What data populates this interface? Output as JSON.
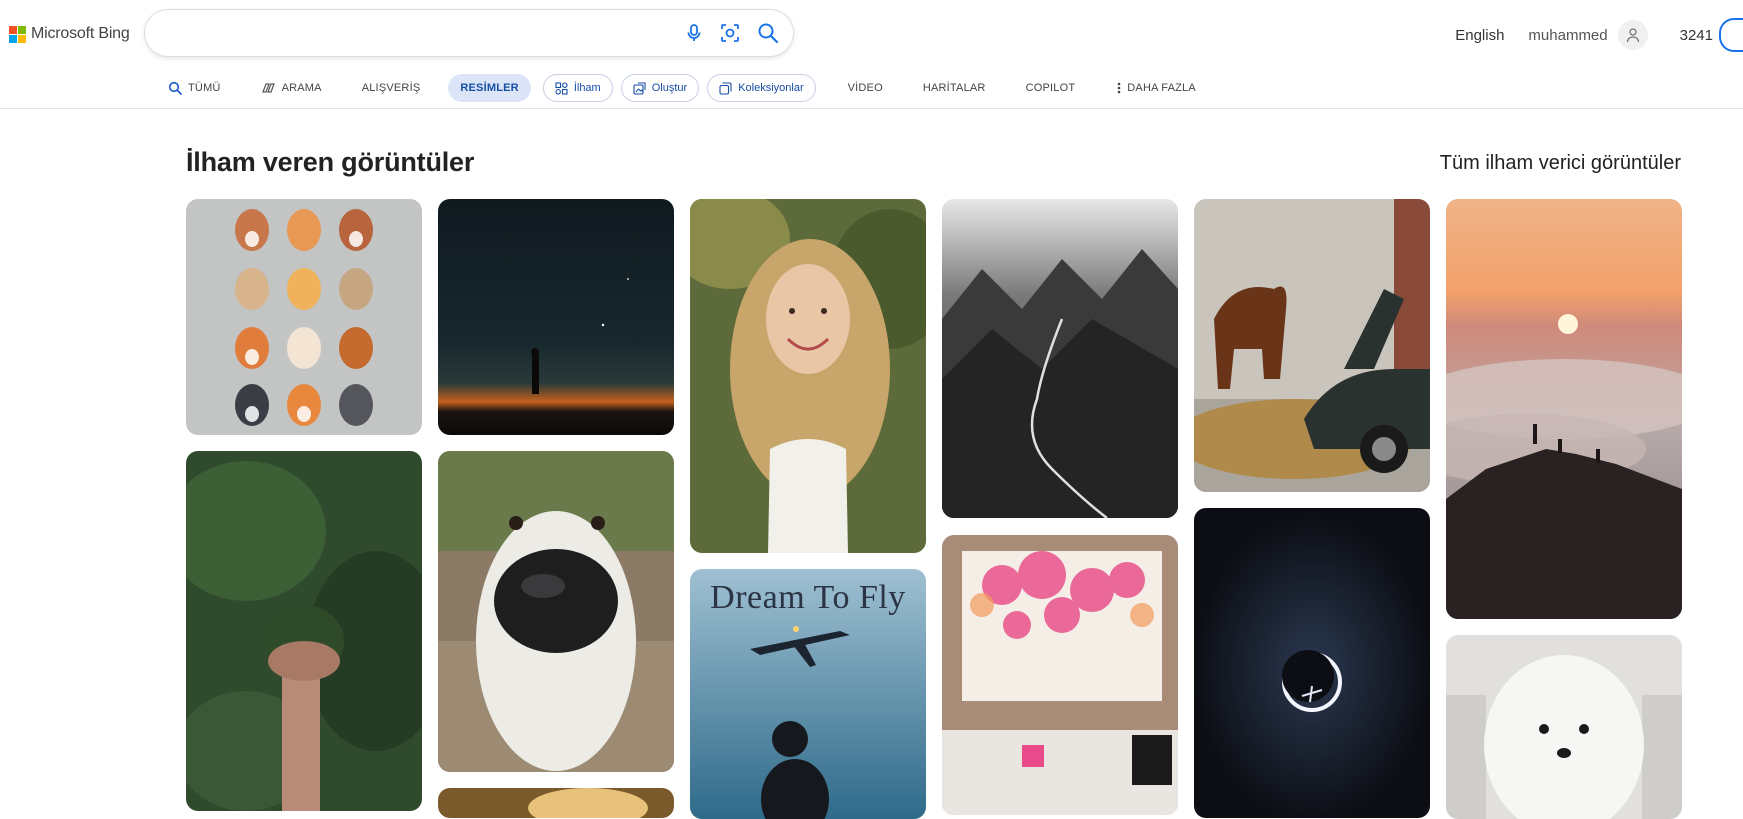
{
  "brand": {
    "name": "Microsoft Bing",
    "logo_colors": [
      "#f25022",
      "#7fba00",
      "#00a4ef",
      "#ffb900"
    ]
  },
  "search": {
    "value": "",
    "placeholder": "",
    "icons": [
      "microphone-icon",
      "visual-search-icon",
      "search-icon"
    ]
  },
  "header": {
    "language": "English",
    "username": "muhammed",
    "reward_points": "3241"
  },
  "nav": {
    "tumu": "TÜMÜ",
    "arama": "ARAMA",
    "alisveris": "ALIŞVERİŞ",
    "resimler": "RESİMLER",
    "ilham": "İlham",
    "olustur": "Oluştur",
    "koleksiyonlar": "Koleksiyonlar",
    "video": "VİDEO",
    "haritalar": "HARİTALAR",
    "copilot": "COPILOT",
    "daha_fazla": "DAHA FAZLA"
  },
  "section": {
    "title": "İlham veren görüntüler",
    "see_all": "Tüm ilham verici görüntüler"
  },
  "images": [
    {
      "name": "image-cartoon-dogs"
    },
    {
      "name": "image-night-sky-silhouette"
    },
    {
      "name": "image-smiling-woman"
    },
    {
      "name": "image-mountain-river"
    },
    {
      "name": "image-horse-and-car"
    },
    {
      "name": "image-sunset-above-clouds"
    },
    {
      "name": "image-hand-holding-moss"
    },
    {
      "name": "image-dog-nose-closeup"
    },
    {
      "name": "image-dream-to-fly",
      "caption": "Dream To Fly"
    },
    {
      "name": "image-flower-painting"
    },
    {
      "name": "image-eclipse-airplane"
    },
    {
      "name": "image-white-fluffy-dog"
    },
    {
      "name": "image-golden-light"
    }
  ],
  "colors": {
    "accent": "#174ea6",
    "active_tab_bg": "#dce4f8",
    "link": "#1a73e8"
  }
}
